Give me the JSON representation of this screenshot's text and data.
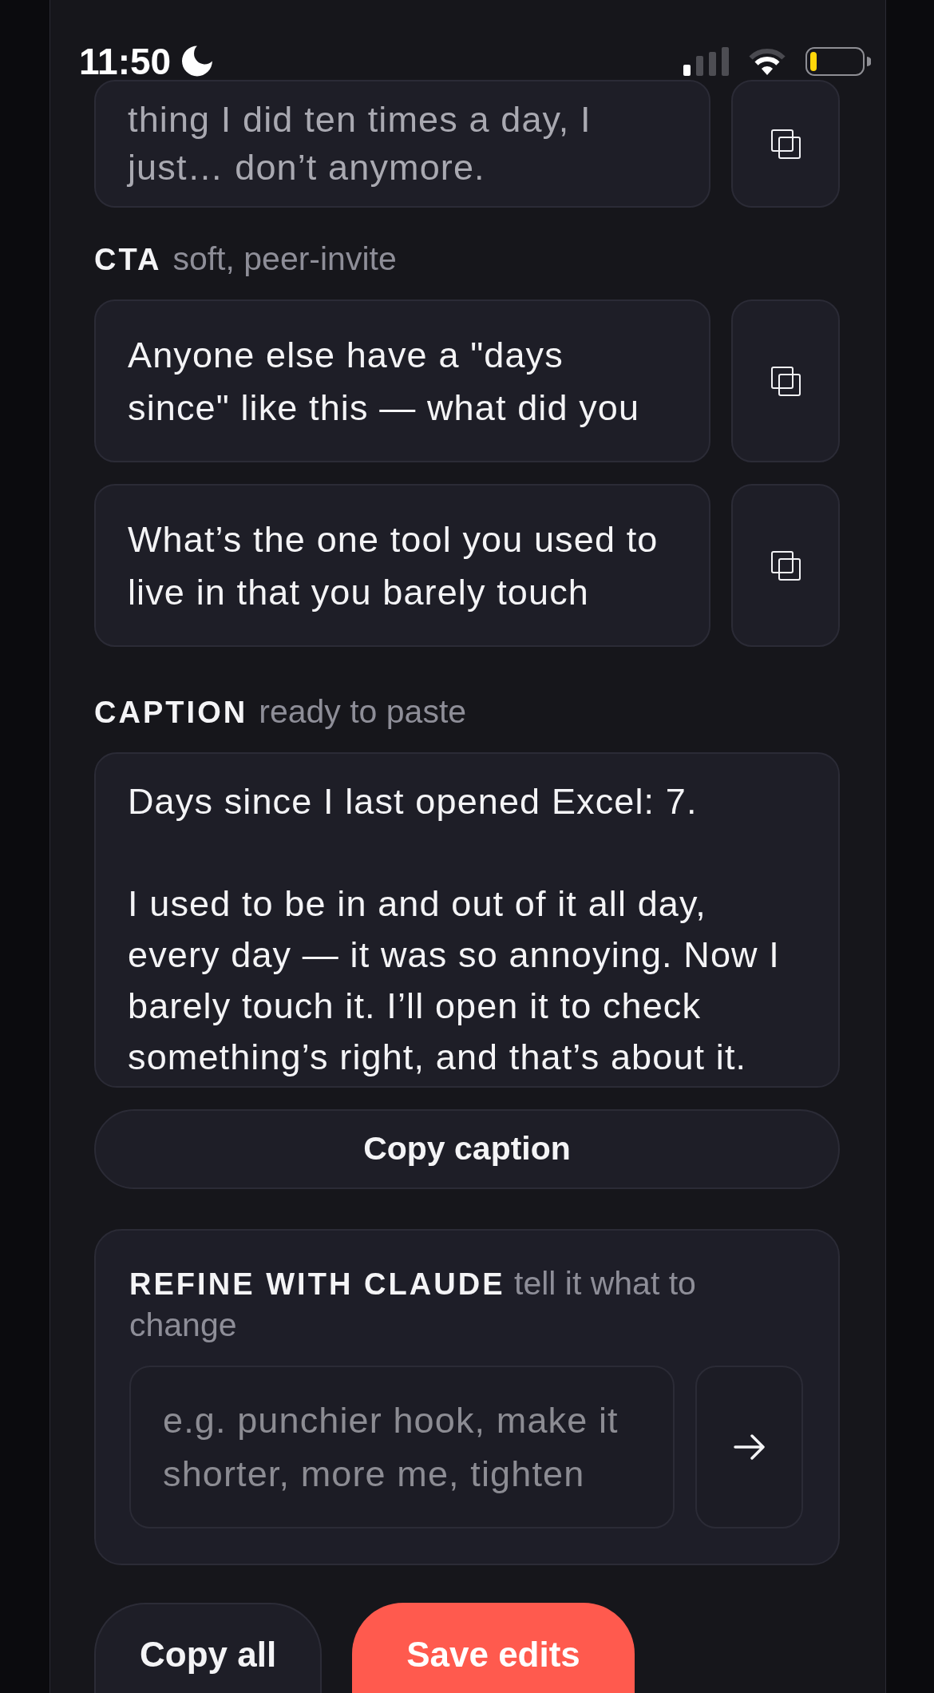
{
  "status_bar": {
    "time": "11:50"
  },
  "hook": {
    "variants": [
      {
        "text": "thing I did ten times a day, I just… don’t anymore."
      }
    ]
  },
  "cta": {
    "label": "CTA",
    "hint": "soft, peer-invite",
    "variants": [
      {
        "text": "Anyone else have a \"days since\" like this — what did you"
      },
      {
        "text": "What’s the one tool you used to live in that you barely touch"
      }
    ]
  },
  "caption": {
    "label": "CAPTION",
    "hint": "ready to paste",
    "text": "Days since I last opened Excel: 7.\n\nI used to be in and out of it all day, every day — it was so annoying. Now I barely touch it. I’ll open it to check something’s right, and that’s about it.",
    "button": "Copy caption"
  },
  "refine": {
    "heading": "**REFINE WITH CLAUDE** tell it what to change",
    "placeholder": "e.g. punchier hook, make it shorter, more me, tighten"
  },
  "actions": [
    {
      "label": "Copy all",
      "kind": "secondary"
    },
    {
      "label": "Save edits",
      "kind": "primary"
    }
  ]
}
